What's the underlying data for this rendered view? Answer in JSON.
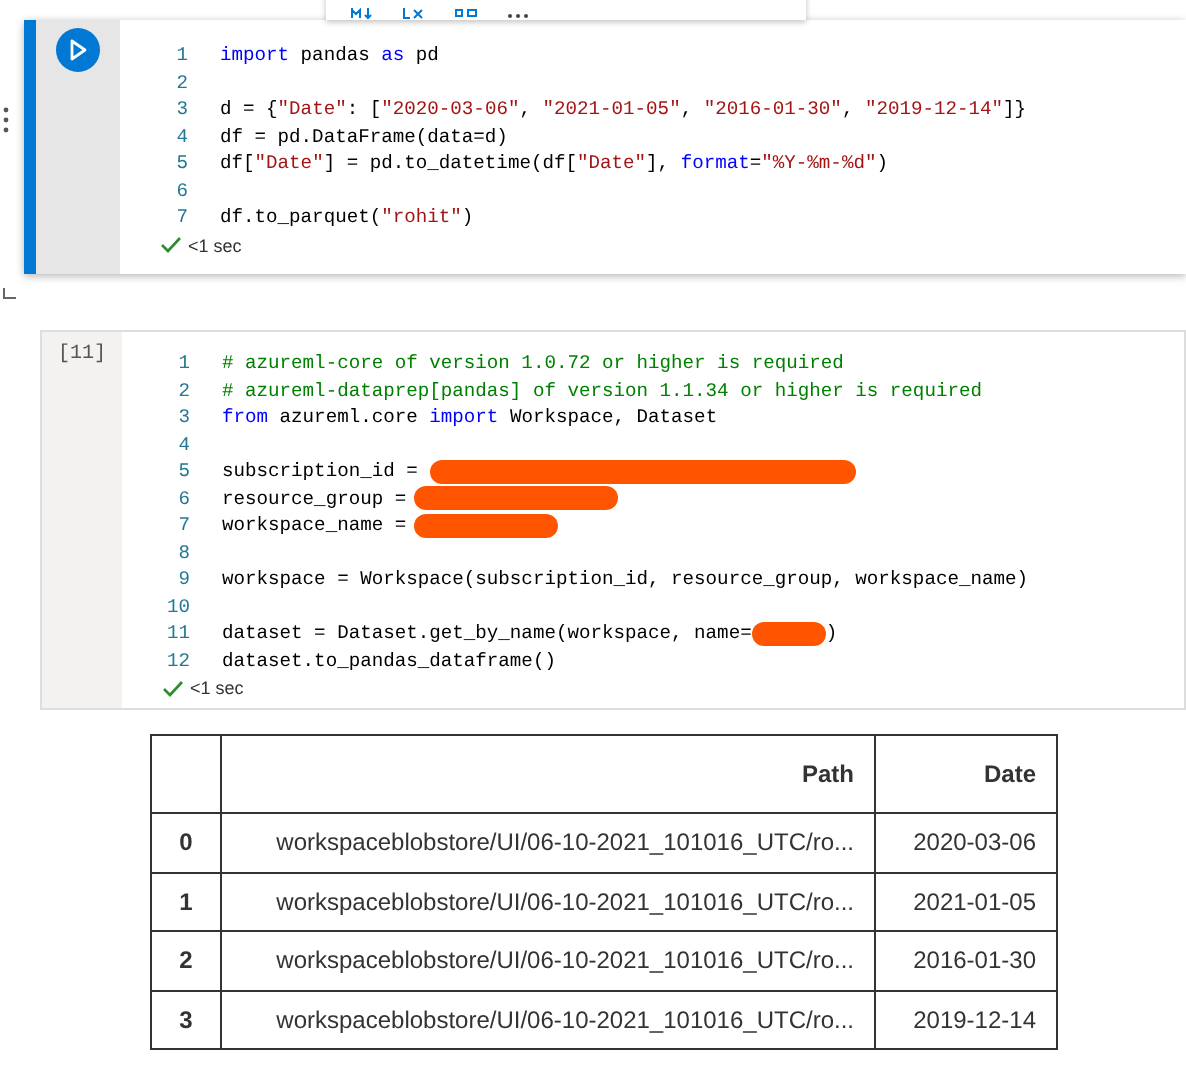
{
  "cells": [
    {
      "selected": true,
      "lines": [
        {
          "number": "1",
          "segments": [
            {
              "kind": "keyword",
              "text": "import"
            },
            {
              "kind": "plain",
              "text": " pandas "
            },
            {
              "kind": "keyword",
              "text": "as"
            },
            {
              "kind": "plain",
              "text": " pd"
            }
          ]
        },
        {
          "number": "2"
        },
        {
          "number": "3",
          "segments": [
            {
              "kind": "plain",
              "text": "d = {"
            },
            {
              "kind": "string",
              "text": "\"Date\""
            },
            {
              "kind": "plain",
              "text": ": ["
            },
            {
              "kind": "string",
              "text": "\"2020-03-06\""
            },
            {
              "kind": "plain",
              "text": ", "
            },
            {
              "kind": "string",
              "text": "\"2021-01-05\""
            },
            {
              "kind": "plain",
              "text": ", "
            },
            {
              "kind": "string",
              "text": "\"2016-01-30\""
            },
            {
              "kind": "plain",
              "text": ", "
            },
            {
              "kind": "string",
              "text": "\"2019-12-14\""
            },
            {
              "kind": "plain",
              "text": "]}"
            }
          ]
        },
        {
          "number": "4",
          "segments": [
            {
              "kind": "plain",
              "text": "df = pd.DataFrame(data=d)"
            }
          ]
        },
        {
          "number": "5",
          "segments": [
            {
              "kind": "plain",
              "text": "df["
            },
            {
              "kind": "string",
              "text": "\"Date\""
            },
            {
              "kind": "plain",
              "text": "] = pd.to_datetime(df["
            },
            {
              "kind": "string",
              "text": "\"Date\""
            },
            {
              "kind": "plain",
              "text": "], "
            },
            {
              "kind": "keyword",
              "text": "format"
            },
            {
              "kind": "plain",
              "text": "="
            },
            {
              "kind": "string",
              "text": "\"%Y-%m-%d\""
            },
            {
              "kind": "plain",
              "text": ")"
            }
          ]
        },
        {
          "number": "6"
        },
        {
          "number": "7",
          "segments": [
            {
              "kind": "plain",
              "text": "df.to_parquet("
            },
            {
              "kind": "string",
              "text": "\"rohit\""
            },
            {
              "kind": "plain",
              "text": ")"
            }
          ]
        }
      ],
      "status": "<1 sec"
    },
    {
      "selected": false,
      "execution_count": "[11]",
      "lines": [
        {
          "number": "1",
          "segments": [
            {
              "kind": "comment",
              "text": "# azureml-core of version 1.0.72 or higher is required"
            }
          ]
        },
        {
          "number": "2",
          "segments": [
            {
              "kind": "comment",
              "text": "# azureml-dataprep[pandas] of version 1.1.34 or higher is required"
            }
          ]
        },
        {
          "number": "3",
          "segments": [
            {
              "kind": "keyword",
              "text": "from"
            },
            {
              "kind": "plain",
              "text": " azureml.core "
            },
            {
              "kind": "keyword",
              "text": "import"
            },
            {
              "kind": "plain",
              "text": " Workspace, Dataset"
            }
          ]
        },
        {
          "number": "4"
        },
        {
          "number": "5",
          "segments": [
            {
              "kind": "plain",
              "text": "subscription_id = "
            },
            {
              "kind": "redaction"
            }
          ]
        },
        {
          "number": "6",
          "segments": [
            {
              "kind": "plain",
              "text": "resource_group ="
            },
            {
              "kind": "redaction"
            }
          ]
        },
        {
          "number": "7",
          "segments": [
            {
              "kind": "plain",
              "text": "workspace_name ="
            },
            {
              "kind": "redaction"
            }
          ]
        },
        {
          "number": "8"
        },
        {
          "number": "9",
          "segments": [
            {
              "kind": "plain",
              "text": "workspace = Workspace(subscription_id, resource_group, workspace_name)"
            }
          ]
        },
        {
          "number": "10"
        },
        {
          "number": "11",
          "segments": [
            {
              "kind": "plain",
              "text": "dataset = Dataset.get_by_name(workspace, name="
            },
            {
              "kind": "redaction"
            },
            {
              "kind": "plain",
              "text": ")"
            }
          ]
        },
        {
          "number": "12",
          "segments": [
            {
              "kind": "plain",
              "text": "dataset.to_pandas_dataframe()"
            }
          ]
        }
      ],
      "status": "<1 sec"
    }
  ],
  "table": {
    "columns": [
      "",
      "Path",
      "Date"
    ],
    "rows": [
      [
        "0",
        "workspaceblobstore/UI/06-10-2021_101016_UTC/ro...",
        "2020-03-06"
      ],
      [
        "1",
        "workspaceblobstore/UI/06-10-2021_101016_UTC/ro...",
        "2021-01-05"
      ],
      [
        "2",
        "workspaceblobstore/UI/06-10-2021_101016_UTC/ro...",
        "2016-01-30"
      ],
      [
        "3",
        "workspaceblobstore/UI/06-10-2021_101016_UTC/ro...",
        "2019-12-14"
      ]
    ]
  }
}
